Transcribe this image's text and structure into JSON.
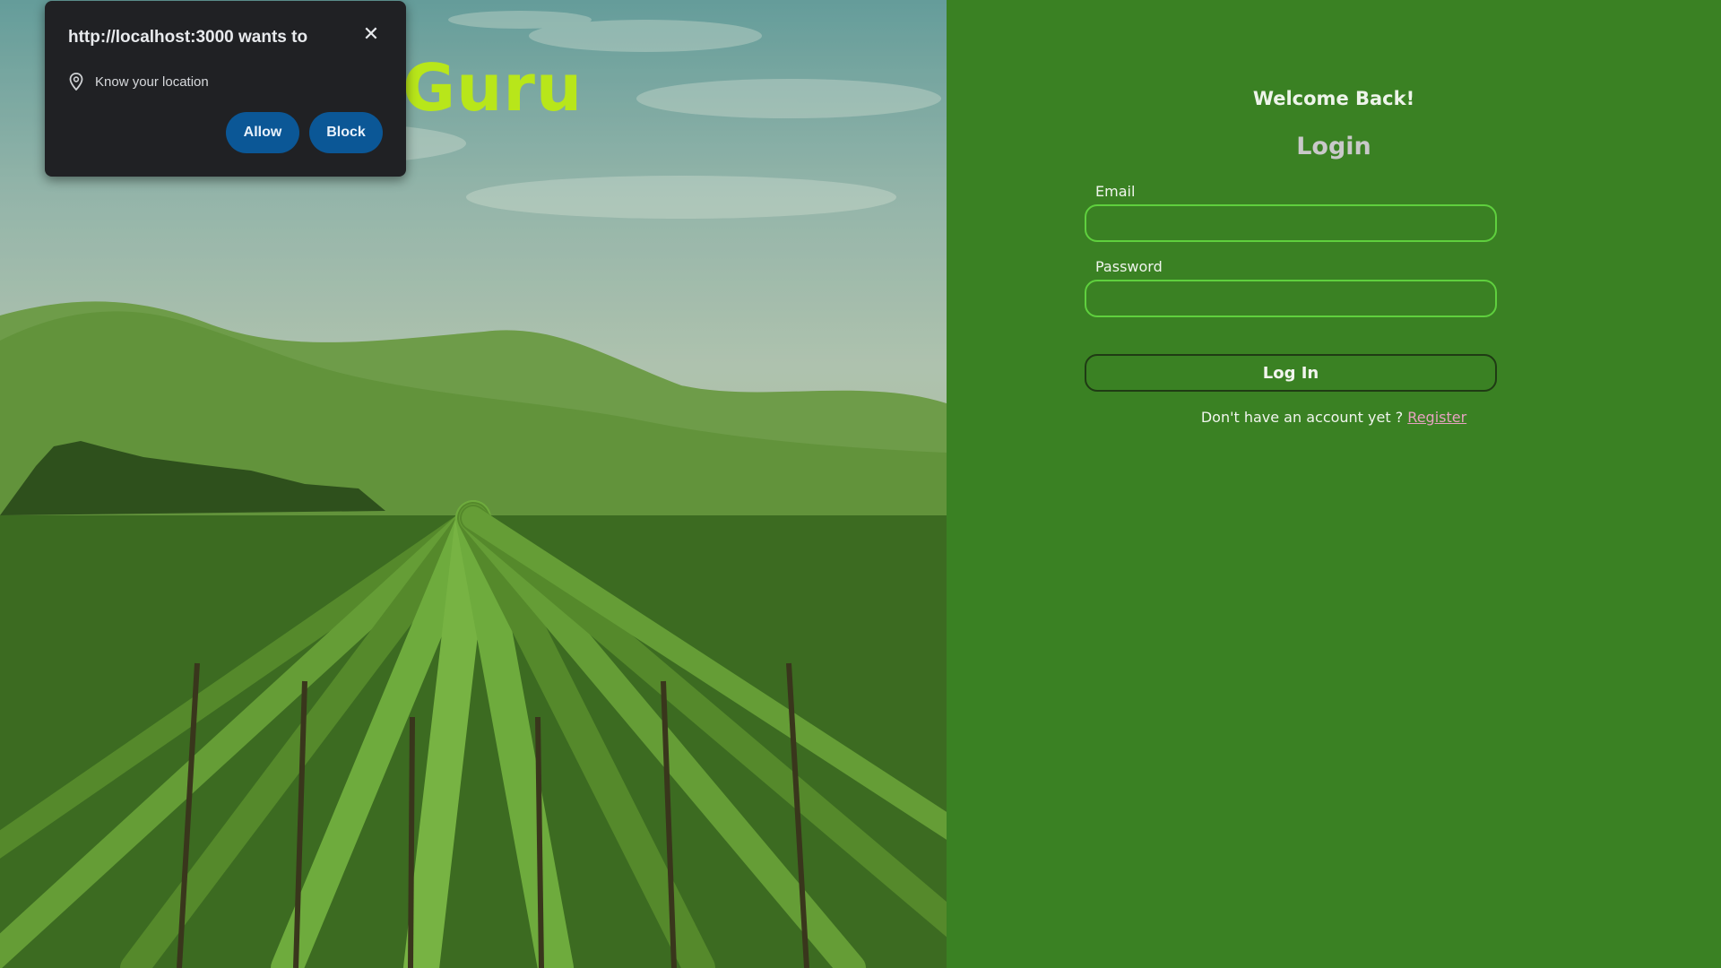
{
  "hero": {
    "title_fragment": "Guru"
  },
  "login": {
    "welcome": "Welcome Back!",
    "heading": "Login",
    "email_label": "Email",
    "email_value": "",
    "password_label": "Password",
    "password_value": "",
    "submit_label": "Log In",
    "register_prompt": "Don't have an account yet ?",
    "register_link": "Register"
  },
  "permission_popup": {
    "title": "http://localhost:3000 wants to",
    "permission": "Know your location",
    "allow_label": "Allow",
    "block_label": "Block",
    "close_symbol": "✕",
    "icon": "location-pin-icon"
  },
  "colors": {
    "panel_bg": "#3a8123",
    "input_border": "#5fd03e",
    "hero_title": "#b8e61a",
    "popup_bg": "#202124",
    "popup_button": "#0b5796",
    "register_link": "#e6a3c0"
  }
}
